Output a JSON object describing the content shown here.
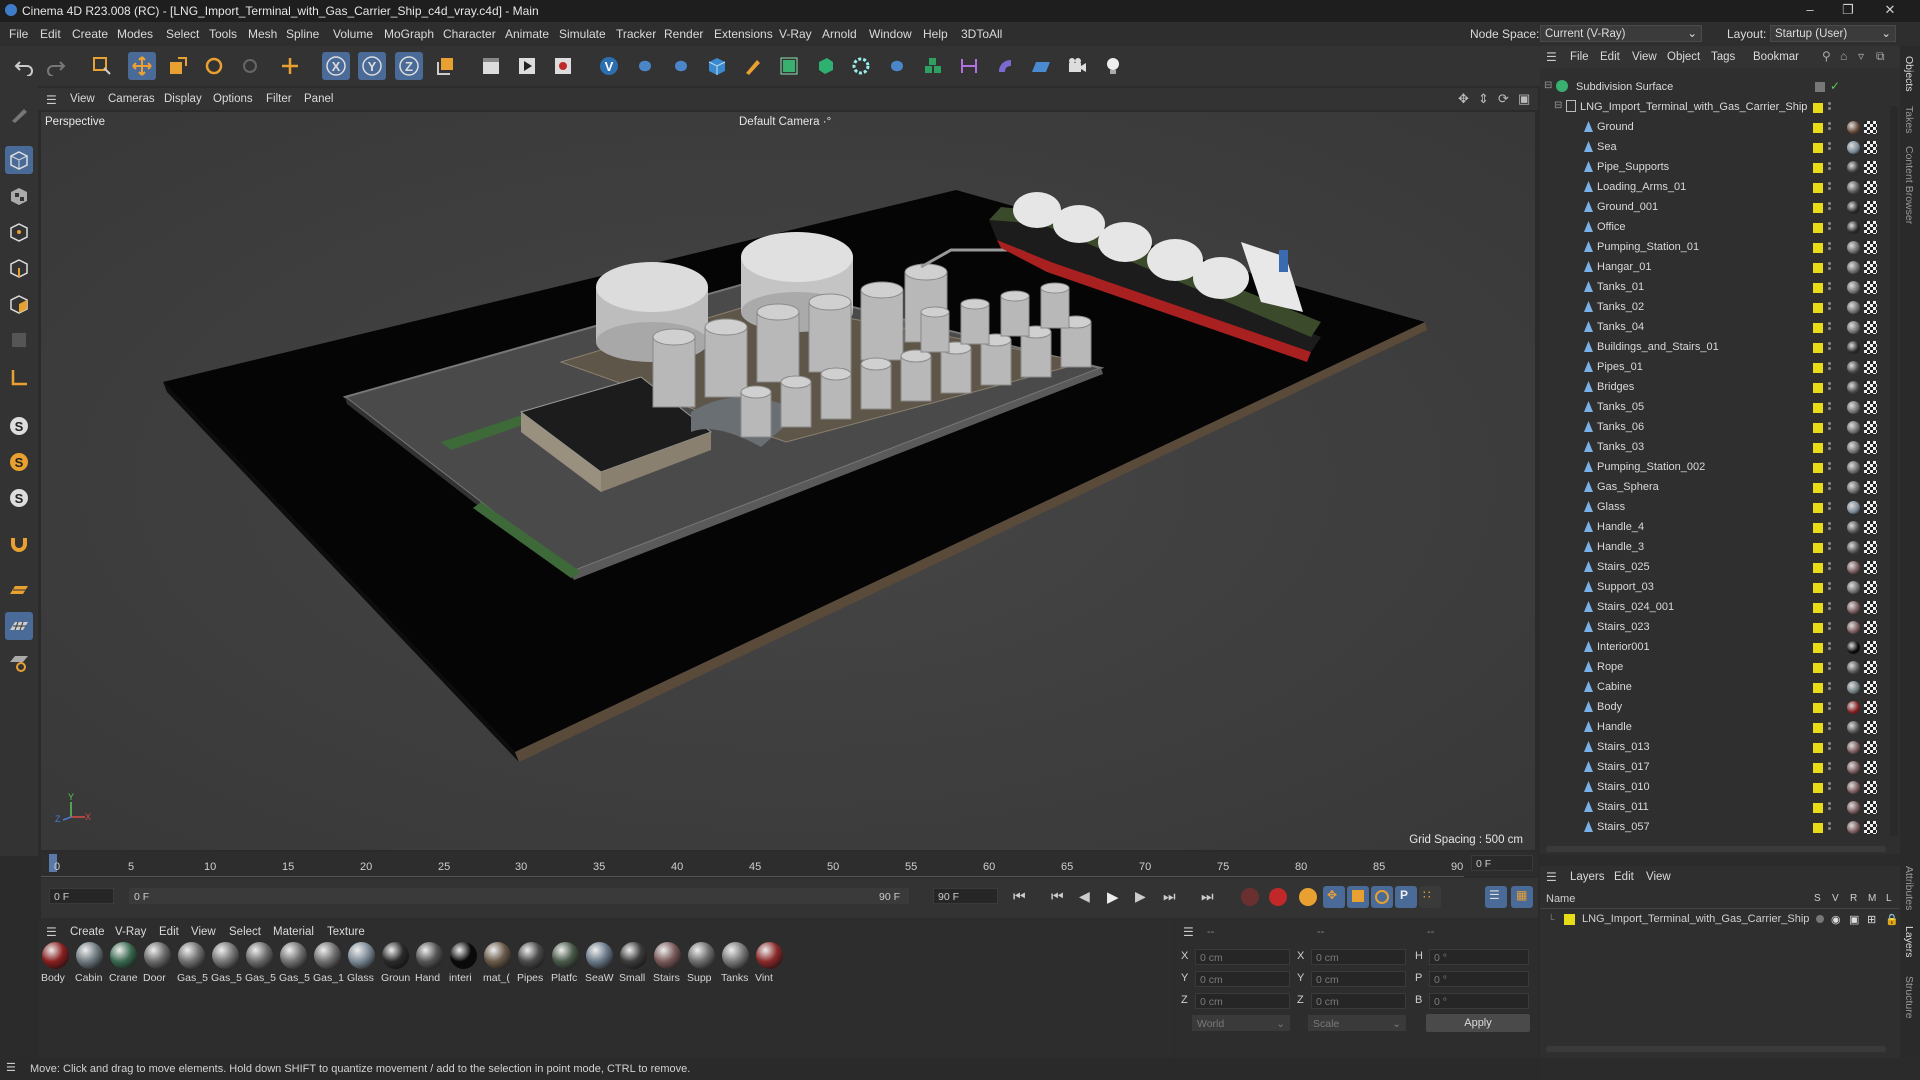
{
  "window": {
    "title": "Cinema 4D R23.008 (RC) - [LNG_Import_Terminal_with_Gas_Carrier_Ship_c4d_vray.c4d] - Main"
  },
  "menu": [
    "File",
    "Edit",
    "Create",
    "Modes",
    "Select",
    "Tools",
    "Mesh",
    "Spline",
    "Volume",
    "MoGraph",
    "Character",
    "Animate",
    "Simulate",
    "Tracker",
    "Render",
    "Extensions",
    "V-Ray",
    "Arnold",
    "Window",
    "Help",
    "3DToAll"
  ],
  "node_space": {
    "label": "Node Space:",
    "value": "Current (V-Ray)"
  },
  "layout": {
    "label": "Layout:",
    "value": "Startup (User)"
  },
  "viewport": {
    "menu": [
      "View",
      "Cameras",
      "Display",
      "Options",
      "Filter",
      "Panel"
    ],
    "name": "Perspective",
    "camera": "Default Camera",
    "grid_spacing": "Grid Spacing : 500 cm",
    "axis_labels": {
      "x": "X",
      "y": "Y",
      "z": "Z"
    }
  },
  "timeline": {
    "ticks": [
      "0",
      "5",
      "10",
      "15",
      "20",
      "25",
      "30",
      "35",
      "40",
      "45",
      "50",
      "55",
      "60",
      "65",
      "70",
      "75",
      "80",
      "85",
      "90"
    ],
    "current_frame": "0 F",
    "end_frame_display": "0 F"
  },
  "playbar": {
    "start": "0 F",
    "range_start": "0 F",
    "range_end": "90 F",
    "end": "90 F"
  },
  "material_manager": {
    "menu": [
      "Create",
      "V-Ray",
      "Edit",
      "View",
      "Select",
      "Material",
      "Texture"
    ],
    "materials": [
      {
        "name": "Body",
        "color": "#8a2020"
      },
      {
        "name": "Cabin",
        "color": "#6e7a80"
      },
      {
        "name": "Crane",
        "color": "#3a6a50"
      },
      {
        "name": "Door",
        "color": "#6a6a6a"
      },
      {
        "name": "Gas_5",
        "color": "#707070"
      },
      {
        "name": "Gas_5",
        "color": "#767676"
      },
      {
        "name": "Gas_5",
        "color": "#6c6c6c"
      },
      {
        "name": "Gas_5",
        "color": "#727272"
      },
      {
        "name": "Gas_1",
        "color": "#707070"
      },
      {
        "name": "Glass",
        "color": "#7c8a96"
      },
      {
        "name": "Groun",
        "color": "#2a2a2a"
      },
      {
        "name": "Hand",
        "color": "#555555"
      },
      {
        "name": "interi",
        "color": "#0a0a0a"
      },
      {
        "name": "mat_(",
        "color": "#6a5a4a"
      },
      {
        "name": "Pipes",
        "color": "#4a4a4a"
      },
      {
        "name": "Platfc",
        "color": "#4a5a4a"
      },
      {
        "name": "SeaW",
        "color": "#6a7a8a"
      },
      {
        "name": "Small",
        "color": "#3c3c3c"
      },
      {
        "name": "Stairs",
        "color": "#7a5a5a"
      },
      {
        "name": "Supp",
        "color": "#6e6e6e"
      },
      {
        "name": "Tanks",
        "color": "#7a7a7a"
      },
      {
        "name": "Vint",
        "color": "#8a2a2a"
      }
    ]
  },
  "coords": {
    "col1_header": "--",
    "col2_header": "--",
    "col3_header": "--",
    "rows": [
      {
        "a": "X",
        "av": "0 cm",
        "b": "X",
        "bv": "0 cm",
        "c": "H",
        "cv": "0 °"
      },
      {
        "a": "Y",
        "av": "0 cm",
        "b": "Y",
        "bv": "0 cm",
        "c": "P",
        "cv": "0 °"
      },
      {
        "a": "Z",
        "av": "0 cm",
        "b": "Z",
        "bv": "0 cm",
        "c": "B",
        "cv": "0 °"
      }
    ],
    "world": "World",
    "scale": "Scale",
    "apply": "Apply"
  },
  "status": "Move: Click and drag to move elements. Hold down SHIFT to quantize movement / add to the selection in point mode, CTRL to remove.",
  "object_manager": {
    "menu": [
      "File",
      "Edit",
      "View",
      "Object",
      "Tags",
      "Bookmar"
    ],
    "root": "Subdivision Surface",
    "group": "LNG_Import_Terminal_with_Gas_Carrier_Ship",
    "objects": [
      {
        "name": "Ground",
        "mat": "#6a4a3a"
      },
      {
        "name": "Sea",
        "mat": "#7a8a96"
      },
      {
        "name": "Pipe_Supports",
        "mat": "#3a3a3a"
      },
      {
        "name": "Loading_Arms_01",
        "mat": "#5a5a5a"
      },
      {
        "name": "Ground_001",
        "mat": "#2a2a2a"
      },
      {
        "name": "Office",
        "mat": "#2a2a2a"
      },
      {
        "name": "Pumping_Station_01",
        "mat": "#6a6a6a"
      },
      {
        "name": "Hangar_01",
        "mat": "#6a6a6a"
      },
      {
        "name": "Tanks_01",
        "mat": "#707070"
      },
      {
        "name": "Tanks_02",
        "mat": "#707070"
      },
      {
        "name": "Tanks_04",
        "mat": "#707070"
      },
      {
        "name": "Buildings_and_Stairs_01",
        "mat": "#2a2a2a"
      },
      {
        "name": "Pipes_01",
        "mat": "#4a4a4a"
      },
      {
        "name": "Bridges",
        "mat": "#4a4a4a"
      },
      {
        "name": "Tanks_05",
        "mat": "#707070"
      },
      {
        "name": "Tanks_06",
        "mat": "#707070"
      },
      {
        "name": "Tanks_03",
        "mat": "#707070"
      },
      {
        "name": "Pumping_Station_002",
        "mat": "#6a6a6a"
      },
      {
        "name": "Gas_Sphera",
        "mat": "#6a6a6a"
      },
      {
        "name": "Glass",
        "mat": "#7c8a96"
      },
      {
        "name": "Handle_4",
        "mat": "#555555"
      },
      {
        "name": "Handle_3",
        "mat": "#555555"
      },
      {
        "name": "Stairs_025",
        "mat": "#7a5a5a"
      },
      {
        "name": "Support_03",
        "mat": "#6e6e6e"
      },
      {
        "name": "Stairs_024_001",
        "mat": "#7a5a5a"
      },
      {
        "name": "Stairs_023",
        "mat": "#7a5a5a"
      },
      {
        "name": "Interior001",
        "mat": "#0a0a0a"
      },
      {
        "name": "Rope",
        "mat": "#5a5a5a"
      },
      {
        "name": "Cabine",
        "mat": "#6e7a80"
      },
      {
        "name": "Body",
        "mat": "#8a2020"
      },
      {
        "name": "Handle",
        "mat": "#555555"
      },
      {
        "name": "Stairs_013",
        "mat": "#7a5a5a"
      },
      {
        "name": "Stairs_017",
        "mat": "#7a5a5a"
      },
      {
        "name": "Stairs_010",
        "mat": "#7a5a5a"
      },
      {
        "name": "Stairs_011",
        "mat": "#7a5a5a"
      },
      {
        "name": "Stairs_057",
        "mat": "#7a5a5a"
      }
    ]
  },
  "layer_manager": {
    "menu": [
      "Layers",
      "Edit",
      "View"
    ],
    "name_header": "Name",
    "flags": [
      "S",
      "V",
      "R",
      "M",
      "L"
    ],
    "layer": "LNG_Import_Terminal_with_Gas_Carrier_Ship"
  },
  "side_tabs": [
    "Objects",
    "Takes",
    "Content Browser",
    "Attributes",
    "Layers",
    "Structure"
  ],
  "colors": {
    "accent": "#4a6a98",
    "layer_yellow": "#e8dc18",
    "record_red": "#c0282a"
  }
}
